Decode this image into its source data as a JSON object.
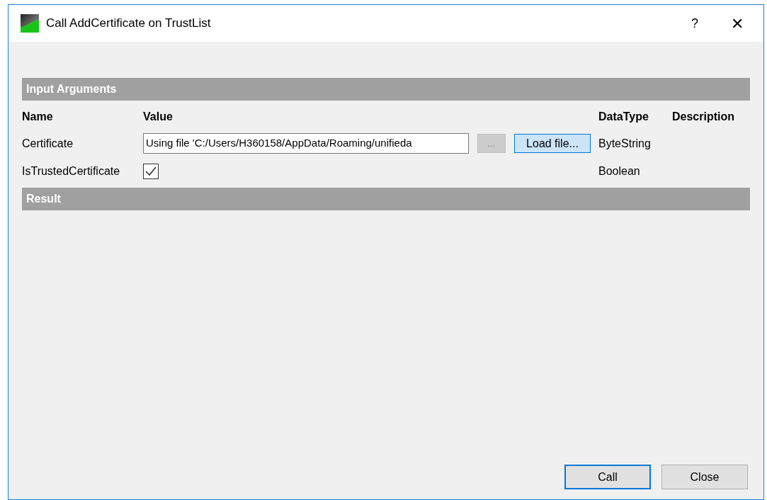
{
  "window": {
    "title": "Call AddCertificate on TrustList",
    "help": "?",
    "close": "✕"
  },
  "input_section": {
    "title": "Input Arguments",
    "columns": [
      "Name",
      "Value",
      "DataType",
      "Description"
    ],
    "rows": [
      {
        "kind": "file",
        "name": "Certificate",
        "value": "Using file 'C:/Users/H360158/AppData/Roaming/unifieda",
        "browse": {
          "label": "...",
          "disabled": true
        },
        "load": {
          "label": "Load file...",
          "focused": true
        },
        "datatype": "ByteString"
      },
      {
        "kind": "checkbox",
        "name": "IsTrustedCertificate",
        "checked": true,
        "datatype": "Boolean"
      }
    ]
  },
  "result_section": {
    "title": "Result"
  },
  "buttons": [
    {
      "label": "Call",
      "focused": true
    },
    {
      "label": "Close",
      "focused": false
    }
  ]
}
